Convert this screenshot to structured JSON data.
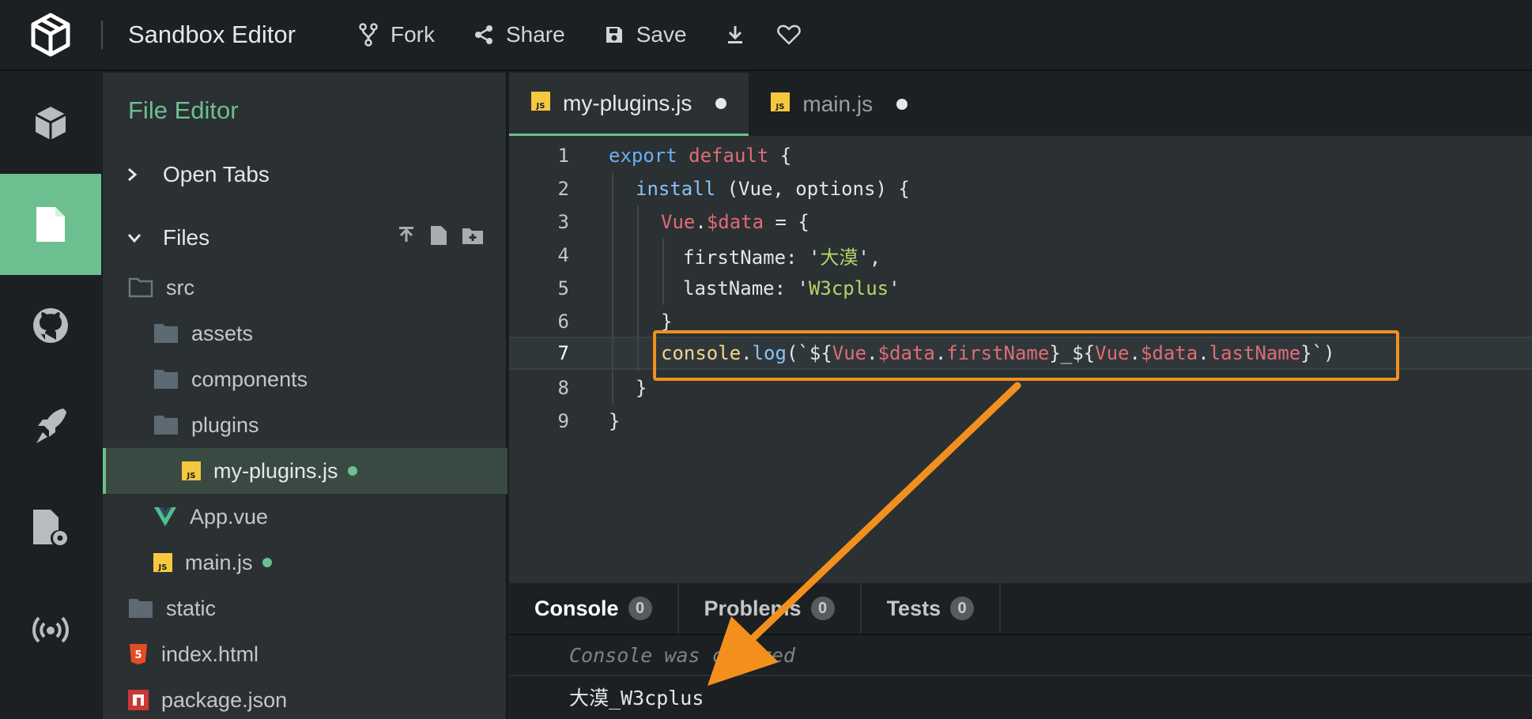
{
  "app": {
    "title": "Sandbox Editor"
  },
  "toolbar": {
    "fork_label": "Fork",
    "share_label": "Share",
    "save_label": "Save"
  },
  "panel": {
    "title": "File Editor",
    "open_tabs_label": "Open Tabs",
    "files_label": "Files",
    "tree": [
      {
        "name": "src",
        "type": "folder-open"
      },
      {
        "name": "assets",
        "type": "folder"
      },
      {
        "name": "components",
        "type": "folder"
      },
      {
        "name": "plugins",
        "type": "folder"
      },
      {
        "name": "my-plugins.js",
        "type": "js",
        "modified": true,
        "selected": true
      },
      {
        "name": "App.vue",
        "type": "vue"
      },
      {
        "name": "main.js",
        "type": "js",
        "modified": true
      },
      {
        "name": "static",
        "type": "folder"
      },
      {
        "name": "index.html",
        "type": "html"
      },
      {
        "name": "package.json",
        "type": "npm"
      }
    ]
  },
  "editor": {
    "tabs": [
      {
        "label": "my-plugins.js",
        "icon": "js-icon",
        "active": true
      },
      {
        "label": "main.js",
        "icon": "js-icon",
        "active": false
      }
    ],
    "line_numbers": [
      "1",
      "2",
      "3",
      "4",
      "5",
      "6",
      "7",
      "8",
      "9"
    ]
  },
  "console": {
    "tabs": [
      {
        "label": "Console",
        "count": "0"
      },
      {
        "label": "Problems",
        "count": "0"
      },
      {
        "label": "Tests",
        "count": "0"
      }
    ],
    "cleared_message": "Console was cleared",
    "output": "大漠_W3cplus"
  },
  "colors": {
    "accent": "#6cc08f",
    "highlight": "#f3901d",
    "js_yellow": "#f5c840"
  }
}
